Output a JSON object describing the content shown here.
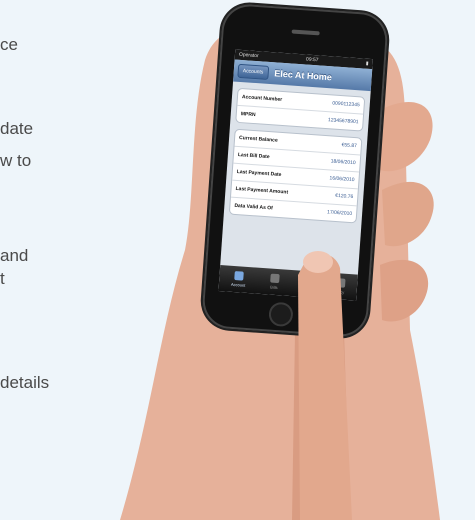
{
  "background_text": [
    "ce",
    "date",
    "w to",
    "and",
    "t",
    "details"
  ],
  "phone": {
    "status": {
      "carrier": "Operator",
      "time": "09:57"
    },
    "nav": {
      "back_label": "Accounts",
      "title": "Elec At Home"
    },
    "group1": [
      {
        "label": "Account Number",
        "value": "0090112345"
      },
      {
        "label": "MPRN",
        "value": "12345678901"
      }
    ],
    "group2": [
      {
        "label": "Current Balance",
        "value": "€55.87"
      },
      {
        "label": "Last Bill Date",
        "value": "18/06/2010"
      },
      {
        "label": "Last Payment Date",
        "value": "16/06/2010"
      },
      {
        "label": "Last Payment Amount",
        "value": "€120.76"
      },
      {
        "label": "Data Valid As Of",
        "value": "17/06/2010"
      }
    ],
    "tabs": [
      {
        "label": "Account",
        "active": true
      },
      {
        "label": "Bills",
        "active": false
      },
      {
        "label": "",
        "active": false
      },
      {
        "label": "ency",
        "active": false
      }
    ]
  },
  "colors": {
    "background": "#eef5fa",
    "navbar": "#5579a8",
    "value_text": "#3a5d93"
  }
}
